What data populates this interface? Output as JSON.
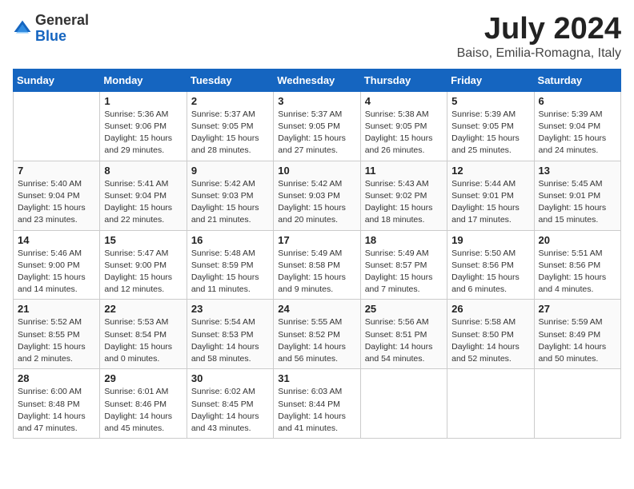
{
  "header": {
    "logo_line1": "General",
    "logo_line2": "Blue",
    "month_title": "July 2024",
    "location": "Baiso, Emilia-Romagna, Italy"
  },
  "weekdays": [
    "Sunday",
    "Monday",
    "Tuesday",
    "Wednesday",
    "Thursday",
    "Friday",
    "Saturday"
  ],
  "weeks": [
    [
      null,
      {
        "day": "1",
        "sunrise": "5:36 AM",
        "sunset": "9:06 PM",
        "daylight": "15 hours and 29 minutes."
      },
      {
        "day": "2",
        "sunrise": "5:37 AM",
        "sunset": "9:05 PM",
        "daylight": "15 hours and 28 minutes."
      },
      {
        "day": "3",
        "sunrise": "5:37 AM",
        "sunset": "9:05 PM",
        "daylight": "15 hours and 27 minutes."
      },
      {
        "day": "4",
        "sunrise": "5:38 AM",
        "sunset": "9:05 PM",
        "daylight": "15 hours and 26 minutes."
      },
      {
        "day": "5",
        "sunrise": "5:39 AM",
        "sunset": "9:05 PM",
        "daylight": "15 hours and 25 minutes."
      },
      {
        "day": "6",
        "sunrise": "5:39 AM",
        "sunset": "9:04 PM",
        "daylight": "15 hours and 24 minutes."
      }
    ],
    [
      {
        "day": "7",
        "sunrise": "5:40 AM",
        "sunset": "9:04 PM",
        "daylight": "15 hours and 23 minutes."
      },
      {
        "day": "8",
        "sunrise": "5:41 AM",
        "sunset": "9:04 PM",
        "daylight": "15 hours and 22 minutes."
      },
      {
        "day": "9",
        "sunrise": "5:42 AM",
        "sunset": "9:03 PM",
        "daylight": "15 hours and 21 minutes."
      },
      {
        "day": "10",
        "sunrise": "5:42 AM",
        "sunset": "9:03 PM",
        "daylight": "15 hours and 20 minutes."
      },
      {
        "day": "11",
        "sunrise": "5:43 AM",
        "sunset": "9:02 PM",
        "daylight": "15 hours and 18 minutes."
      },
      {
        "day": "12",
        "sunrise": "5:44 AM",
        "sunset": "9:01 PM",
        "daylight": "15 hours and 17 minutes."
      },
      {
        "day": "13",
        "sunrise": "5:45 AM",
        "sunset": "9:01 PM",
        "daylight": "15 hours and 15 minutes."
      }
    ],
    [
      {
        "day": "14",
        "sunrise": "5:46 AM",
        "sunset": "9:00 PM",
        "daylight": "15 hours and 14 minutes."
      },
      {
        "day": "15",
        "sunrise": "5:47 AM",
        "sunset": "9:00 PM",
        "daylight": "15 hours and 12 minutes."
      },
      {
        "day": "16",
        "sunrise": "5:48 AM",
        "sunset": "8:59 PM",
        "daylight": "15 hours and 11 minutes."
      },
      {
        "day": "17",
        "sunrise": "5:49 AM",
        "sunset": "8:58 PM",
        "daylight": "15 hours and 9 minutes."
      },
      {
        "day": "18",
        "sunrise": "5:49 AM",
        "sunset": "8:57 PM",
        "daylight": "15 hours and 7 minutes."
      },
      {
        "day": "19",
        "sunrise": "5:50 AM",
        "sunset": "8:56 PM",
        "daylight": "15 hours and 6 minutes."
      },
      {
        "day": "20",
        "sunrise": "5:51 AM",
        "sunset": "8:56 PM",
        "daylight": "15 hours and 4 minutes."
      }
    ],
    [
      {
        "day": "21",
        "sunrise": "5:52 AM",
        "sunset": "8:55 PM",
        "daylight": "15 hours and 2 minutes."
      },
      {
        "day": "22",
        "sunrise": "5:53 AM",
        "sunset": "8:54 PM",
        "daylight": "15 hours and 0 minutes."
      },
      {
        "day": "23",
        "sunrise": "5:54 AM",
        "sunset": "8:53 PM",
        "daylight": "14 hours and 58 minutes."
      },
      {
        "day": "24",
        "sunrise": "5:55 AM",
        "sunset": "8:52 PM",
        "daylight": "14 hours and 56 minutes."
      },
      {
        "day": "25",
        "sunrise": "5:56 AM",
        "sunset": "8:51 PM",
        "daylight": "14 hours and 54 minutes."
      },
      {
        "day": "26",
        "sunrise": "5:58 AM",
        "sunset": "8:50 PM",
        "daylight": "14 hours and 52 minutes."
      },
      {
        "day": "27",
        "sunrise": "5:59 AM",
        "sunset": "8:49 PM",
        "daylight": "14 hours and 50 minutes."
      }
    ],
    [
      {
        "day": "28",
        "sunrise": "6:00 AM",
        "sunset": "8:48 PM",
        "daylight": "14 hours and 47 minutes."
      },
      {
        "day": "29",
        "sunrise": "6:01 AM",
        "sunset": "8:46 PM",
        "daylight": "14 hours and 45 minutes."
      },
      {
        "day": "30",
        "sunrise": "6:02 AM",
        "sunset": "8:45 PM",
        "daylight": "14 hours and 43 minutes."
      },
      {
        "day": "31",
        "sunrise": "6:03 AM",
        "sunset": "8:44 PM",
        "daylight": "14 hours and 41 minutes."
      },
      null,
      null,
      null
    ]
  ],
  "sunrise_label": "Sunrise:",
  "sunset_label": "Sunset:",
  "daylight_label": "Daylight:"
}
